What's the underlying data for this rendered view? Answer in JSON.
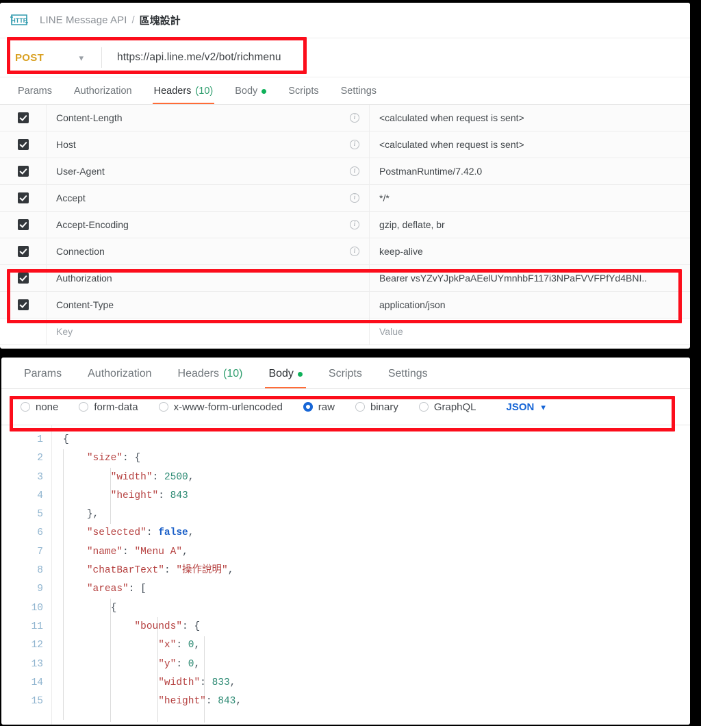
{
  "app": {
    "logo_icon": "http-logo-icon",
    "breadcrumb_parent": "LINE Message API",
    "breadcrumb_separator": "/",
    "breadcrumb_current": "區塊設計"
  },
  "request": {
    "method": "POST",
    "method_caret_icon": "chevron-down-icon",
    "url": "https://api.line.me/v2/bot/richmenu"
  },
  "tabs_top": [
    {
      "label": "Params",
      "active": false
    },
    {
      "label": "Authorization",
      "active": false
    },
    {
      "label": "Headers",
      "count": "(10)",
      "active": true
    },
    {
      "label": "Body",
      "dot": true,
      "active": false
    },
    {
      "label": "Scripts",
      "active": false
    },
    {
      "label": "Settings",
      "active": false
    }
  ],
  "headers_table": {
    "placeholder_key": "Key",
    "placeholder_value": "Value",
    "info_glyph": "i",
    "rows": [
      {
        "checked": true,
        "key": "Content-Length",
        "info": true,
        "value": "<calculated when request is sent>"
      },
      {
        "checked": true,
        "key": "Host",
        "info": true,
        "value": "<calculated when request is sent>"
      },
      {
        "checked": true,
        "key": "User-Agent",
        "info": true,
        "value": "PostmanRuntime/7.42.0"
      },
      {
        "checked": true,
        "key": "Accept",
        "info": true,
        "value": "*/*"
      },
      {
        "checked": true,
        "key": "Accept-Encoding",
        "info": true,
        "value": "gzip, deflate, br"
      },
      {
        "checked": true,
        "key": "Connection",
        "info": true,
        "value": "keep-alive"
      },
      {
        "checked": true,
        "key": "Authorization",
        "info": false,
        "value": "Bearer vsYZvYJpkPaAEelUYmnhbF117i3NPaFVVFPfYd4BNI.."
      },
      {
        "checked": true,
        "key": "Content-Type",
        "info": false,
        "value": "application/json"
      }
    ]
  },
  "tabs_bottom": [
    {
      "label": "Params",
      "active": false
    },
    {
      "label": "Authorization",
      "active": false
    },
    {
      "label": "Headers",
      "count": "(10)",
      "active": false
    },
    {
      "label": "Body",
      "dot": true,
      "active": true
    },
    {
      "label": "Scripts",
      "active": false
    },
    {
      "label": "Settings",
      "active": false
    }
  ],
  "body_types": [
    {
      "label": "none",
      "selected": false
    },
    {
      "label": "form-data",
      "selected": false
    },
    {
      "label": "x-www-form-urlencoded",
      "selected": false
    },
    {
      "label": "raw",
      "selected": true
    },
    {
      "label": "binary",
      "selected": false
    },
    {
      "label": "GraphQL",
      "selected": false
    }
  ],
  "raw_format": {
    "label": "JSON",
    "caret_icon": "chevron-down-icon"
  },
  "editor": {
    "line_numbers": [
      "1",
      "2",
      "3",
      "4",
      "5",
      "6",
      "7",
      "8",
      "9",
      "10",
      "11",
      "12",
      "13",
      "14",
      "15"
    ],
    "lines": [
      [
        {
          "t": "{",
          "c": "brace"
        }
      ],
      [
        {
          "t": "    ",
          "c": "punc"
        },
        {
          "t": "\"size\"",
          "c": "key"
        },
        {
          "t": ": ",
          "c": "punc"
        },
        {
          "t": "{",
          "c": "brace"
        }
      ],
      [
        {
          "t": "        ",
          "c": "punc"
        },
        {
          "t": "\"width\"",
          "c": "key"
        },
        {
          "t": ": ",
          "c": "punc"
        },
        {
          "t": "2500",
          "c": "num"
        },
        {
          "t": ",",
          "c": "punc"
        }
      ],
      [
        {
          "t": "        ",
          "c": "punc"
        },
        {
          "t": "\"height\"",
          "c": "key"
        },
        {
          "t": ": ",
          "c": "punc"
        },
        {
          "t": "843",
          "c": "num"
        }
      ],
      [
        {
          "t": "    ",
          "c": "punc"
        },
        {
          "t": "}",
          "c": "brace"
        },
        {
          "t": ",",
          "c": "punc"
        }
      ],
      [
        {
          "t": "    ",
          "c": "punc"
        },
        {
          "t": "\"selected\"",
          "c": "key"
        },
        {
          "t": ": ",
          "c": "punc"
        },
        {
          "t": "false",
          "c": "bool"
        },
        {
          "t": ",",
          "c": "punc"
        }
      ],
      [
        {
          "t": "    ",
          "c": "punc"
        },
        {
          "t": "\"name\"",
          "c": "key"
        },
        {
          "t": ": ",
          "c": "punc"
        },
        {
          "t": "\"Menu A\"",
          "c": "str"
        },
        {
          "t": ",",
          "c": "punc"
        }
      ],
      [
        {
          "t": "    ",
          "c": "punc"
        },
        {
          "t": "\"chatBarText\"",
          "c": "key"
        },
        {
          "t": ": ",
          "c": "punc"
        },
        {
          "t": "\"操作說明\"",
          "c": "str"
        },
        {
          "t": ",",
          "c": "punc"
        }
      ],
      [
        {
          "t": "    ",
          "c": "punc"
        },
        {
          "t": "\"areas\"",
          "c": "key"
        },
        {
          "t": ": ",
          "c": "punc"
        },
        {
          "t": "[",
          "c": "brace"
        }
      ],
      [
        {
          "t": "        ",
          "c": "punc"
        },
        {
          "t": "{",
          "c": "brace"
        }
      ],
      [
        {
          "t": "            ",
          "c": "punc"
        },
        {
          "t": "\"bounds\"",
          "c": "key"
        },
        {
          "t": ": ",
          "c": "punc"
        },
        {
          "t": "{",
          "c": "brace"
        }
      ],
      [
        {
          "t": "                ",
          "c": "punc"
        },
        {
          "t": "\"x\"",
          "c": "key"
        },
        {
          "t": ": ",
          "c": "punc"
        },
        {
          "t": "0",
          "c": "num"
        },
        {
          "t": ",",
          "c": "punc"
        }
      ],
      [
        {
          "t": "                ",
          "c": "punc"
        },
        {
          "t": "\"y\"",
          "c": "key"
        },
        {
          "t": ": ",
          "c": "punc"
        },
        {
          "t": "0",
          "c": "num"
        },
        {
          "t": ",",
          "c": "punc"
        }
      ],
      [
        {
          "t": "                ",
          "c": "punc"
        },
        {
          "t": "\"width\"",
          "c": "key"
        },
        {
          "t": ": ",
          "c": "punc"
        },
        {
          "t": "833",
          "c": "num"
        },
        {
          "t": ",",
          "c": "punc"
        }
      ],
      [
        {
          "t": "                ",
          "c": "punc"
        },
        {
          "t": "\"height\"",
          "c": "key"
        },
        {
          "t": ": ",
          "c": "punc"
        },
        {
          "t": "843",
          "c": "num"
        },
        {
          "t": ",",
          "c": "punc"
        }
      ]
    ]
  },
  "colors": {
    "highlight": "#fc0d1b",
    "method": "#d9a021",
    "accent_tab": "#ff6c37",
    "radio_selected": "#1766d6",
    "json_label": "#1766d6",
    "dot_green": "#0fb15a",
    "count_green": "#2f9e6e"
  }
}
